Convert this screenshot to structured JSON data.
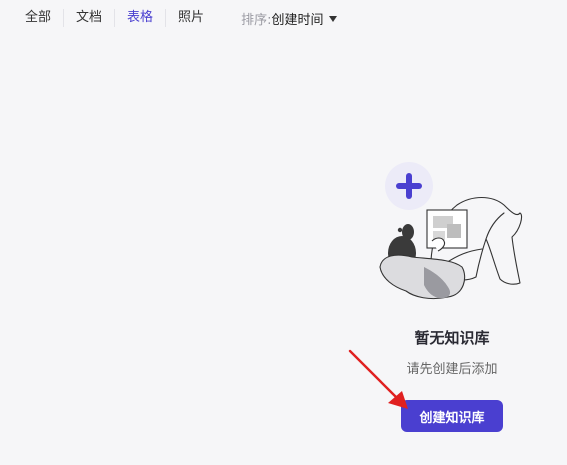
{
  "filter": {
    "tabs": [
      {
        "label": "全部",
        "active": false
      },
      {
        "label": "文档",
        "active": false
      },
      {
        "label": "表格",
        "active": true
      },
      {
        "label": "照片",
        "active": false
      }
    ],
    "sort_label": "排序:",
    "sort_value": "创建时间"
  },
  "empty_state": {
    "title": "暂无知识库",
    "subtitle": "请先创建后添加",
    "button_label": "创建知识库",
    "illustration_icon": "plus-icon"
  },
  "colors": {
    "accent": "#4a3fd0",
    "background": "#f6f6f8",
    "annotation": "#e02020"
  }
}
